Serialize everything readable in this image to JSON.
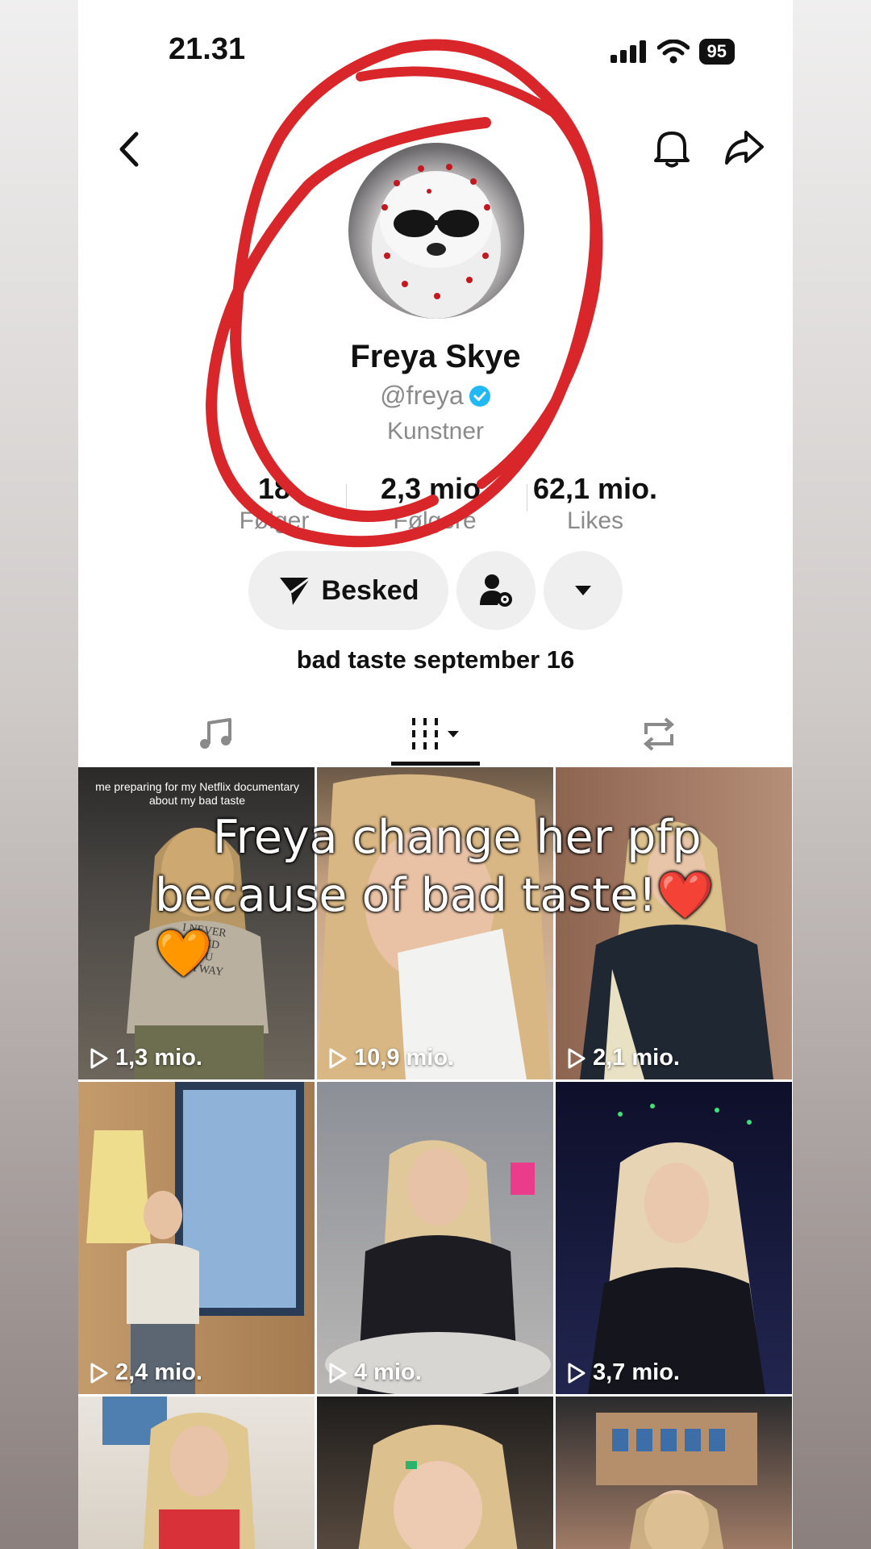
{
  "status": {
    "time": "21.31",
    "battery": "95"
  },
  "profile": {
    "name": "Freya Skye",
    "handle": "@freya",
    "role": "Kunstner",
    "bio": "bad taste september 16"
  },
  "stats": [
    {
      "value": "18",
      "label": "Følger"
    },
    {
      "value": "2,3 mio.",
      "label": "Følgere"
    },
    {
      "value": "62,1 mio.",
      "label": "Likes"
    }
  ],
  "actions": {
    "message_label": "Besked"
  },
  "videos": [
    {
      "views": "1,3 mio.",
      "caption": "me preparing for my Netflix documentary about my bad taste",
      "shirt": "I NEVER LIKED YOU ANYWAY"
    },
    {
      "views": "10,9 mio."
    },
    {
      "views": "2,1 mio."
    },
    {
      "views": "2,4 mio."
    },
    {
      "views": "4 mio."
    },
    {
      "views": "3,7 mio."
    },
    {
      "views": ""
    },
    {
      "views": ""
    },
    {
      "views": ""
    }
  ],
  "overlay": {
    "line1": "Freya change her pfp",
    "line2": "because of bad taste!❤️🧡"
  },
  "colors": {
    "annotation": "#d8262a",
    "verified": "#20b8f5"
  }
}
